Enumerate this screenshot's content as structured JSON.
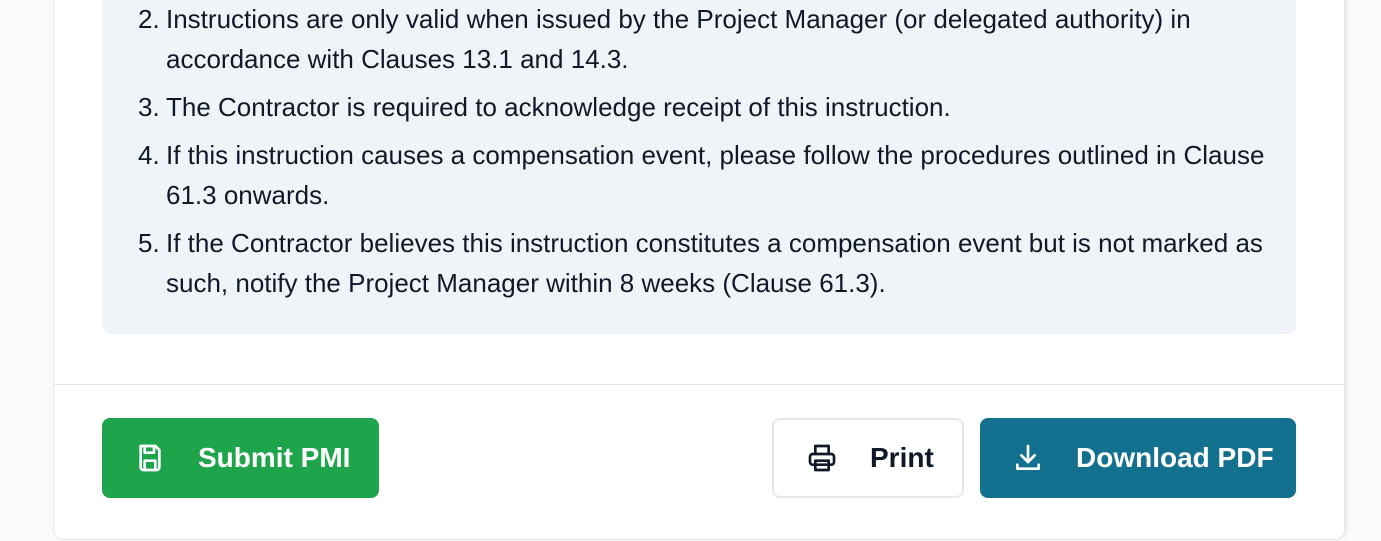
{
  "notes": {
    "items": [
      {
        "num": "2.",
        "text": "Instructions are only valid when issued by the Project Manager (or delegated authority) in accordance with Clauses 13.1 and 14.3."
      },
      {
        "num": "3.",
        "text": "The Contractor is required to acknowledge receipt of this instruction."
      },
      {
        "num": "4.",
        "text": "If this instruction causes a compensation event, please follow the procedures outlined in Clause 61.3 onwards."
      },
      {
        "num": "5.",
        "text": "If the Contractor believes this instruction constitutes a compensation event but is not marked as such, notify the Project Manager within 8 weeks (Clause 61.3)."
      }
    ]
  },
  "actions": {
    "submit_label": "Submit PMI",
    "submit_icon": "save-icon",
    "print_label": "Print",
    "print_icon": "printer-icon",
    "download_label": "Download PDF",
    "download_icon": "download-icon"
  },
  "colors": {
    "submit_bg": "#1ea54c",
    "download_bg": "#13718f",
    "notes_bg": "#f0f4f9"
  }
}
